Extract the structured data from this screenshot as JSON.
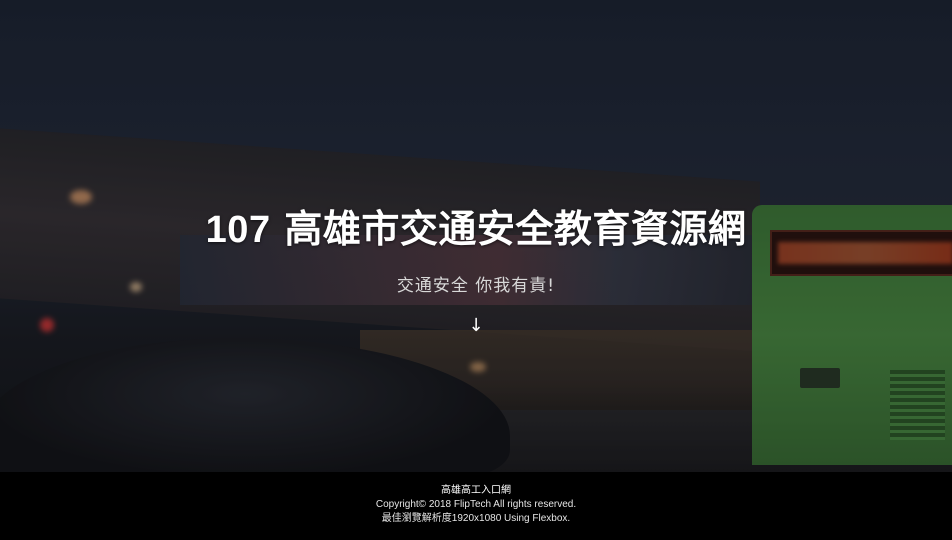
{
  "hero": {
    "title_number": "107",
    "title_text": "高雄市交通安全教育資源網",
    "subtitle": "交通安全 你我有責!",
    "scroll_arrow": "↓",
    "scroll_icon": "arrow-down-icon"
  },
  "footer": {
    "site_name": "高雄高工入口網",
    "copyright": "Copyright© 2018 FlipTech All rights reserved.",
    "browser_note": "最佳瀏覽解析度1920x1080 Using Flexbox."
  }
}
